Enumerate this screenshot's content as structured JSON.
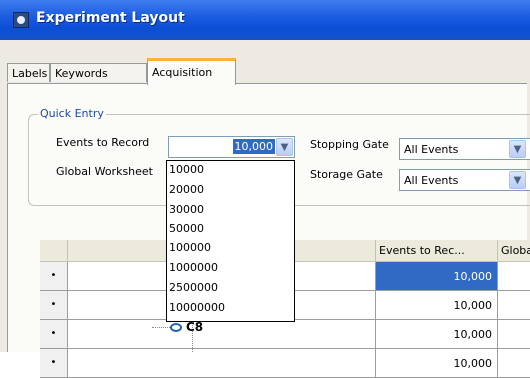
{
  "window": {
    "title": "Experiment Layout"
  },
  "tabs": [
    {
      "label": "Labels"
    },
    {
      "label": "Keywords"
    },
    {
      "label": "Acquisition"
    }
  ],
  "quick_entry": {
    "legend": "Quick Entry",
    "events_label": "Events to Record",
    "events_value": "10,000",
    "stopping_gate_label": "Stopping Gate",
    "stopping_gate_value": "All Events",
    "global_worksheet_label": "Global Worksheet",
    "storage_gate_label": "Storage Gate",
    "storage_gate_value": "All Events"
  },
  "dropdown_options": [
    "10000",
    "20000",
    "30000",
    "50000",
    "100000",
    "1000000",
    "2500000",
    "10000000"
  ],
  "grid": {
    "headers": [
      "Events to Rec...",
      "Globa"
    ],
    "rows": [
      {
        "marker": "•",
        "events": "10,000",
        "selected": true
      },
      {
        "marker": "•",
        "events": "10,000",
        "selected": false
      },
      {
        "marker": "•",
        "events": "10,000",
        "selected": false
      },
      {
        "marker": "•",
        "events": "10,000",
        "selected": false
      }
    ],
    "tree_node_label": "C8"
  },
  "colors": {
    "title_bar": "#0b4ed6",
    "selection": "#316ac5",
    "active_tab_accent": "#f7b532"
  },
  "icons": [
    "app-icon",
    "chevron-down-icon"
  ]
}
